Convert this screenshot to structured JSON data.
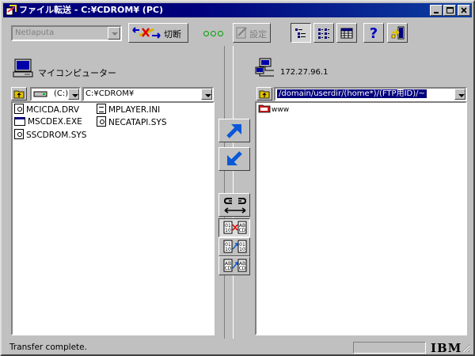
{
  "window": {
    "title": "ファイル転送 - C:¥CDROM¥ (PC)"
  },
  "toolbar": {
    "connection_value": "Netlaputa",
    "disconnect_label": "切断",
    "settings_label": "設定"
  },
  "local": {
    "label": "マイコンピューター",
    "drive": "(C:)",
    "path": "C:¥CDROM¥",
    "files": [
      {
        "name": "MCICDA.DRV",
        "icon": "gear-file-icon"
      },
      {
        "name": "MPLAYER.INI",
        "icon": "text-file-icon"
      },
      {
        "name": "MSCDEX.EXE",
        "icon": "exe-file-icon"
      },
      {
        "name": "NECATAPI.SYS",
        "icon": "gear-file-icon"
      },
      {
        "name": "SSCDROM.SYS",
        "icon": "gear-file-icon"
      }
    ]
  },
  "remote": {
    "label": "172.27.96.1",
    "path": "/domain/userdir/(home*)/(FTP用ID)/~",
    "files": [
      {
        "name": "www",
        "icon": "folder-icon"
      }
    ]
  },
  "status": {
    "text": "Transfer complete."
  },
  "brand": {
    "logo": "IBM"
  },
  "colors": {
    "title_bar": "#00007b",
    "selection": "#00007b",
    "connection_led": "#00a000",
    "arrow_blue": "#0a58d8"
  }
}
